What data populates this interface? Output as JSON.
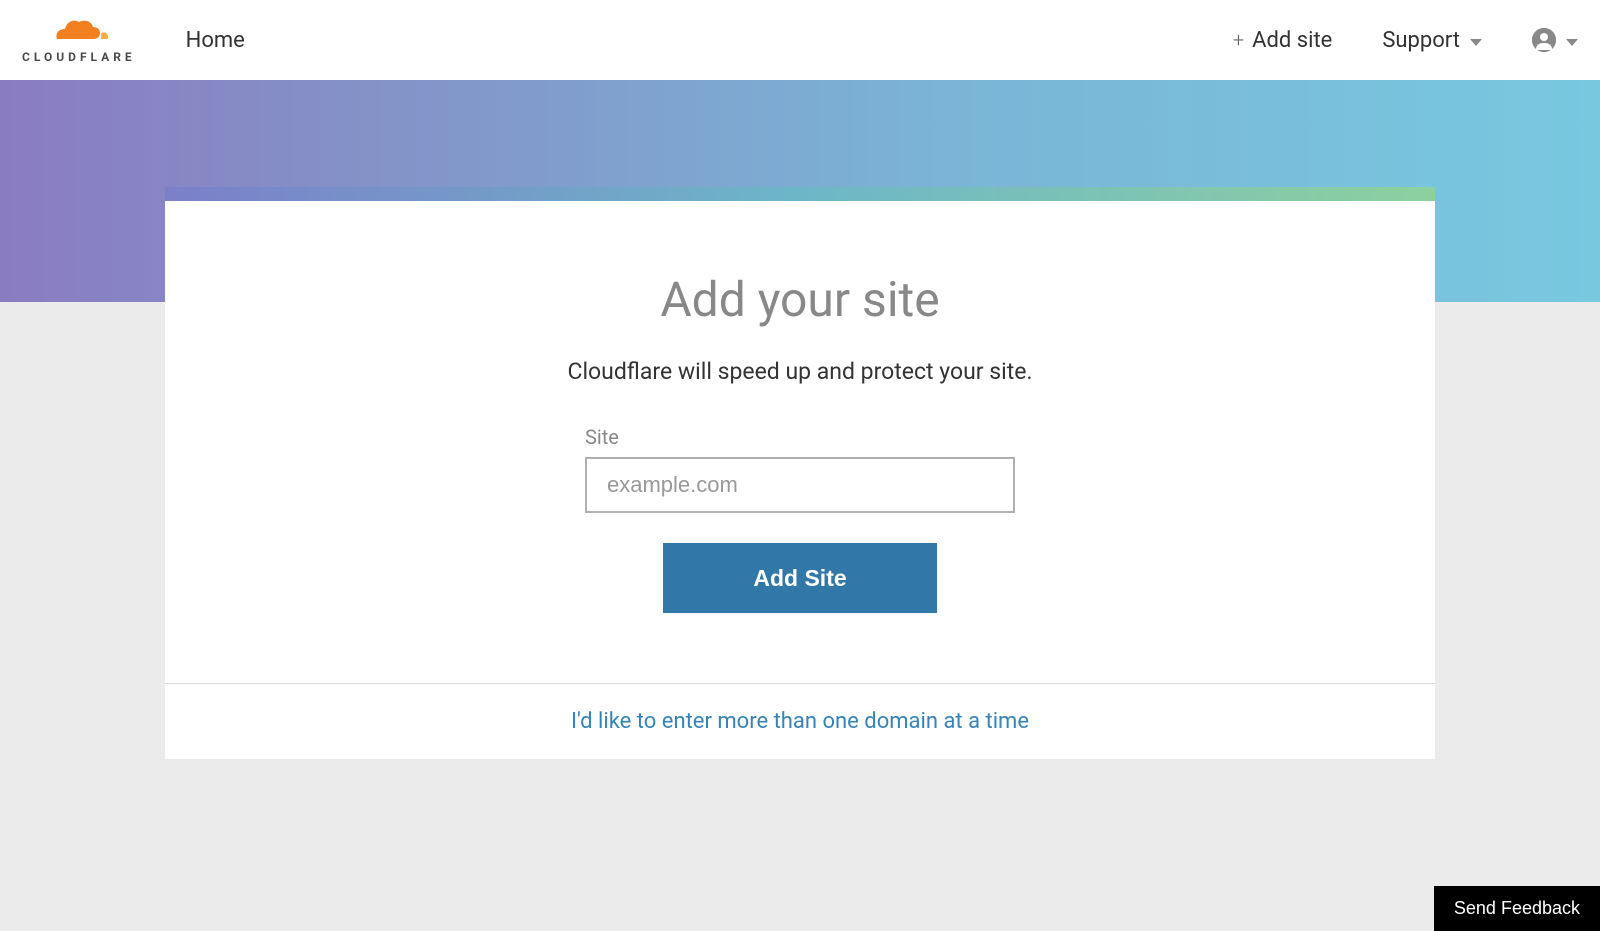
{
  "header": {
    "logo_text": "CLOUDFLARE",
    "home_label": "Home",
    "add_site_label": "Add site",
    "support_label": "Support"
  },
  "main": {
    "title": "Add your site",
    "subtitle": "Cloudflare will speed up and protect your site.",
    "form": {
      "label": "Site",
      "placeholder": "example.com",
      "button_label": "Add Site"
    },
    "multi_domain_link": "I'd like to enter more than one domain at a time"
  },
  "feedback": {
    "button_label": "Send Feedback"
  },
  "colors": {
    "accent": "#f38020",
    "primary_button": "#3177a8",
    "link": "#3683b9"
  }
}
